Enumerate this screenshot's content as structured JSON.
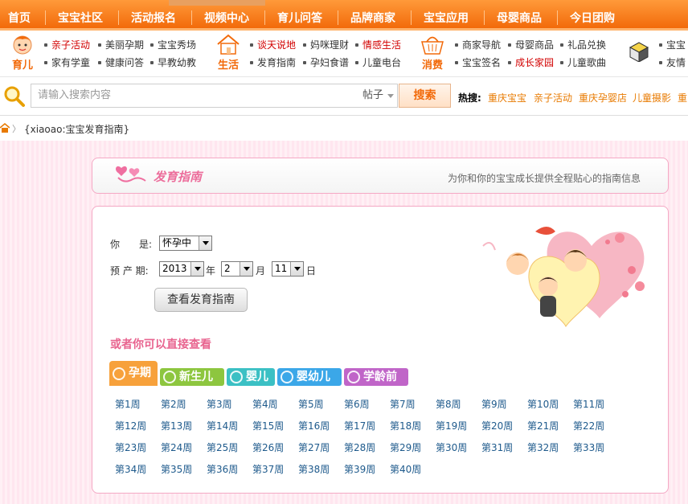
{
  "topnav": {
    "items": [
      "首页",
      "宝宝社区",
      "活动报名",
      "视频中心",
      "育儿问答",
      "品牌商家",
      "宝宝应用",
      "母婴商品",
      "今日团购"
    ]
  },
  "categories": [
    {
      "label": "育儿",
      "icon": "baby-face-icon"
    },
    {
      "label": "生活",
      "icon": "house-icon"
    },
    {
      "label": "消费",
      "icon": "basket-icon"
    },
    {
      "label": "",
      "icon": "gift-box-icon"
    }
  ],
  "catlinks": {
    "yuer": [
      "亲子活动",
      "美丽孕期",
      "宝宝秀场",
      "家有学童",
      "健康问答",
      "早教幼教"
    ],
    "shenghuo": [
      "谈天说地",
      "妈咪理财",
      "情感生活",
      "发育指南",
      "孕妇食谱",
      "儿童电台"
    ],
    "xiaofei": [
      "商家导航",
      "母婴商品",
      "礼品兑换",
      "宝宝签名",
      "成长家园",
      "儿童歌曲"
    ],
    "more": [
      "宝宝",
      "友情"
    ]
  },
  "search": {
    "placeholder": "请输入搜索内容",
    "select": "帖子",
    "button": "搜索",
    "hot_label": "热搜:",
    "hot_links": [
      "重庆宝宝",
      "亲子活动",
      "重庆孕婴店",
      "儿童摄影",
      "重"
    ]
  },
  "breadcrumb": {
    "arrow": "〉",
    "text": "{xiaoao:宝宝发育指南}"
  },
  "title": {
    "main": "发育指南",
    "subtitle": "为你和你的宝宝成长提供全程贴心的指南信息"
  },
  "form": {
    "you_label": "你　　是:",
    "you_value": "怀孕中",
    "due_label": "预 产 期:",
    "year": "2013",
    "year_unit": "年",
    "month": "2",
    "month_unit": "月",
    "day": "11",
    "day_unit": "日",
    "view_button": "查看发育指南"
  },
  "or_label": "或者你可以直接查看",
  "stage_tabs": [
    {
      "label": "孕期",
      "color": "#f7a13b"
    },
    {
      "label": "新生儿",
      "color": "#8dc63f"
    },
    {
      "label": "婴儿",
      "color": "#3bc0c4"
    },
    {
      "label": "婴幼儿",
      "color": "#3ba7e8"
    },
    {
      "label": "学龄前",
      "color": "#c065c8"
    }
  ],
  "weeks": [
    "第1周",
    "第2周",
    "第3周",
    "第4周",
    "第5周",
    "第6周",
    "第7周",
    "第8周",
    "第9周",
    "第10周",
    "第11周",
    "第12周",
    "第13周",
    "第14周",
    "第15周",
    "第16周",
    "第17周",
    "第18周",
    "第19周",
    "第20周",
    "第21周",
    "第22周",
    "第23周",
    "第24周",
    "第25周",
    "第26周",
    "第27周",
    "第28周",
    "第29周",
    "第30周",
    "第31周",
    "第32周",
    "第33周",
    "第34周",
    "第35周",
    "第36周",
    "第37周",
    "第38周",
    "第39周",
    "第40周"
  ]
}
